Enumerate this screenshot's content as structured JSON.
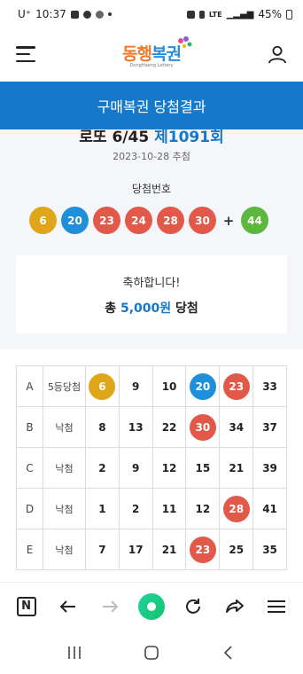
{
  "status_bar": {
    "carrier": "U⁺",
    "time": "10:37",
    "network": "LTE",
    "battery": "45%"
  },
  "header": {
    "logo_text_1": "동행",
    "logo_text_2": "복권",
    "logo_sub": "DongHaeng Lottery"
  },
  "title_bar": {
    "title": "구매복권 당첨결과"
  },
  "draw": {
    "game": "로또 6/45",
    "round": "제1091회",
    "date": "2023-10-28 추첨",
    "winning_label": "당첨번호",
    "numbers": [
      {
        "value": "6",
        "color": "#e0a619"
      },
      {
        "value": "20",
        "color": "#1e8fd8"
      },
      {
        "value": "23",
        "color": "#e2594a"
      },
      {
        "value": "24",
        "color": "#e2594a"
      },
      {
        "value": "28",
        "color": "#e2594a"
      },
      {
        "value": "30",
        "color": "#e2594a"
      }
    ],
    "plus": "+",
    "bonus": {
      "value": "44",
      "color": "#5cb83c"
    }
  },
  "prize": {
    "message": "축하합니다!",
    "prefix": "총 ",
    "amount": "5,000원",
    "suffix": " 당첨"
  },
  "tickets": [
    {
      "label": "A",
      "result": "5등당첨",
      "numbers": [
        {
          "v": "6",
          "hit": "#e0a619"
        },
        {
          "v": "9"
        },
        {
          "v": "10"
        },
        {
          "v": "20",
          "hit": "#1e8fd8"
        },
        {
          "v": "23",
          "hit": "#e2594a"
        },
        {
          "v": "33"
        }
      ]
    },
    {
      "label": "B",
      "result": "낙첨",
      "numbers": [
        {
          "v": "8"
        },
        {
          "v": "13"
        },
        {
          "v": "22"
        },
        {
          "v": "30",
          "hit": "#e2594a"
        },
        {
          "v": "34"
        },
        {
          "v": "37"
        }
      ]
    },
    {
      "label": "C",
      "result": "낙첨",
      "numbers": [
        {
          "v": "2"
        },
        {
          "v": "9"
        },
        {
          "v": "12"
        },
        {
          "v": "15"
        },
        {
          "v": "21"
        },
        {
          "v": "39"
        }
      ]
    },
    {
      "label": "D",
      "result": "낙첨",
      "numbers": [
        {
          "v": "1"
        },
        {
          "v": "2"
        },
        {
          "v": "11"
        },
        {
          "v": "12"
        },
        {
          "v": "28",
          "hit": "#e2594a"
        },
        {
          "v": "41"
        }
      ]
    },
    {
      "label": "E",
      "result": "낙첨",
      "numbers": [
        {
          "v": "7"
        },
        {
          "v": "17"
        },
        {
          "v": "21"
        },
        {
          "v": "23",
          "hit": "#e2594a"
        },
        {
          "v": "25"
        },
        {
          "v": "35"
        }
      ]
    }
  ],
  "browser": {
    "n_label": "N"
  },
  "icons": [
    "menu-icon",
    "user-icon",
    "n-icon",
    "back-icon",
    "forward-icon",
    "home-icon",
    "refresh-icon",
    "share-icon",
    "more-menu-icon",
    "recent-apps-icon",
    "home-nav-icon",
    "back-nav-icon"
  ]
}
